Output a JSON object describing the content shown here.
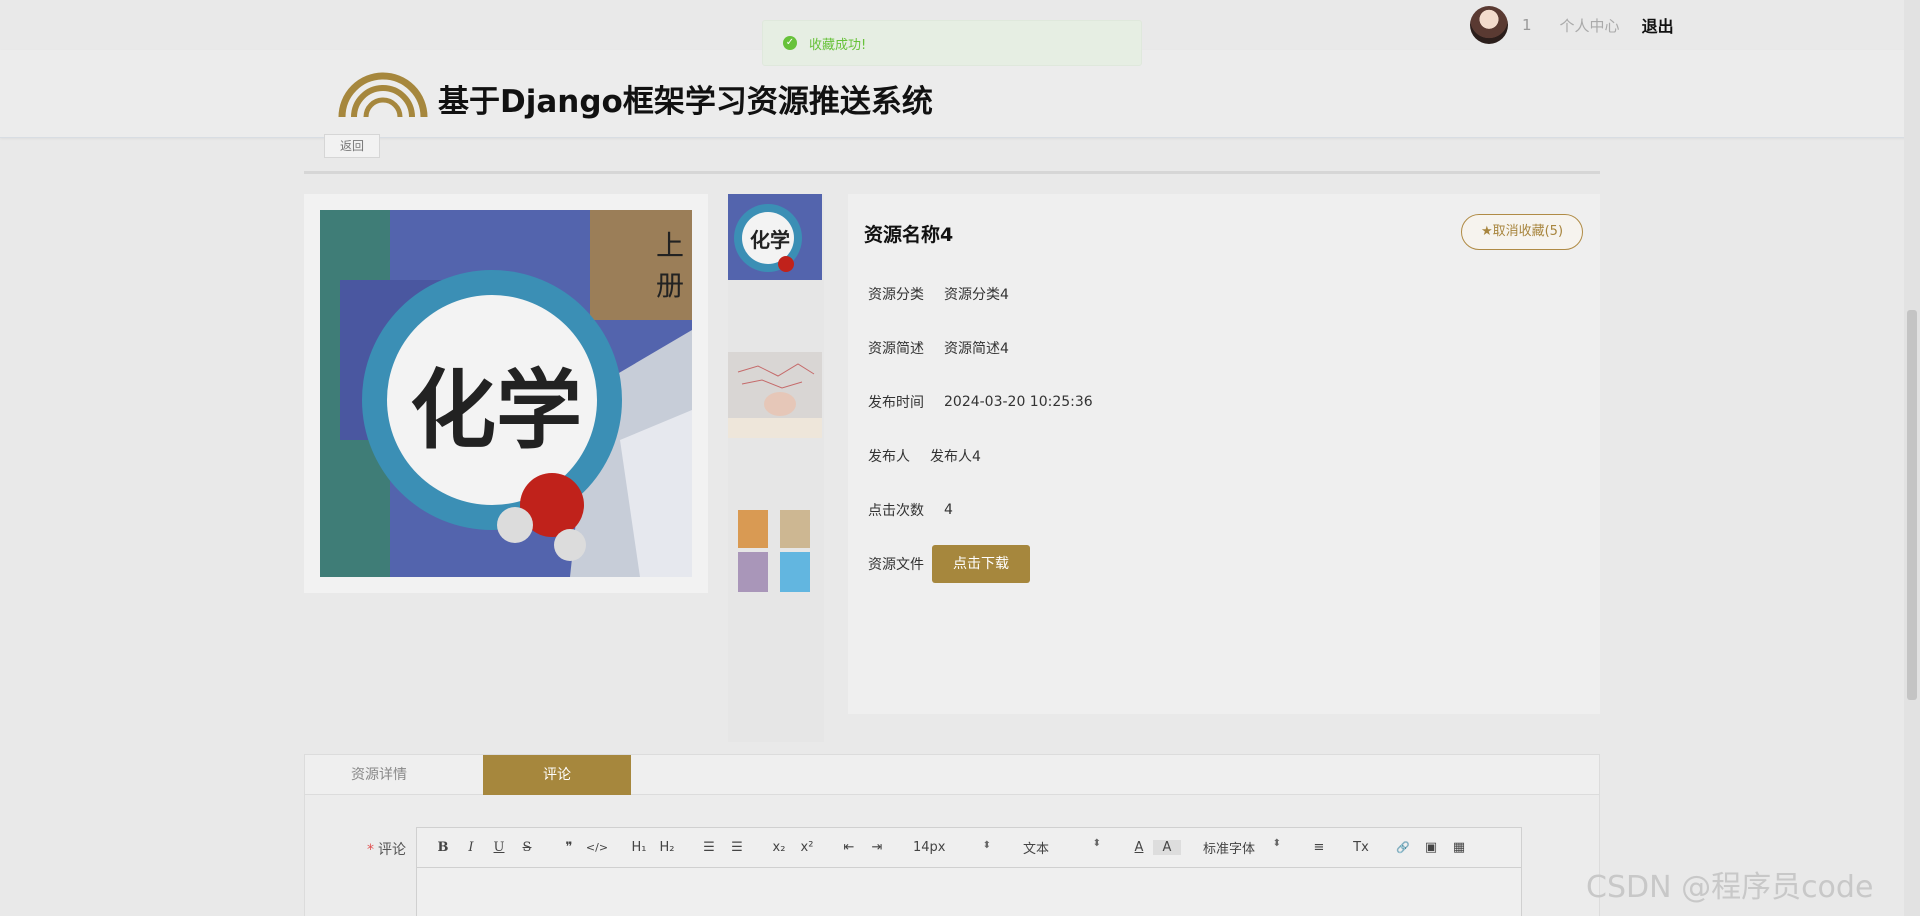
{
  "toast": {
    "message": "收藏成功!"
  },
  "user": {
    "count": "1",
    "personal_center": "个人中心",
    "logout": "退出"
  },
  "header": {
    "title": "基于Django框架学习资源推送系统"
  },
  "back_label": "返回",
  "main_image": {
    "label_big": "化学",
    "label_corner": "上册"
  },
  "thumb_label": "化学",
  "resource": {
    "name": "资源名称4",
    "fav_button": "★取消收藏(5)",
    "fields": [
      {
        "label": "资源分类",
        "value": "资源分类4"
      },
      {
        "label": "资源简述",
        "value": "资源简述4"
      },
      {
        "label": "发布时间",
        "value": "2024-03-20 10:25:36"
      },
      {
        "label": "发布人",
        "value": "发布人4"
      },
      {
        "label": "点击次数",
        "value": "4"
      }
    ],
    "file_label": "资源文件",
    "download_button": "点击下载"
  },
  "tabs": [
    {
      "label": "资源详情"
    },
    {
      "label": "评论"
    }
  ],
  "comment": {
    "required_mark": "*",
    "label": "评论",
    "toolbar": {
      "bold": "B",
      "italic": "I",
      "underline": "U",
      "strike": "S",
      "quote": "❞",
      "code": "</>",
      "h1": "H₁",
      "h2": "H₂",
      "ol": "☰",
      "ul": "☰",
      "sub": "x₂",
      "sup": "x²",
      "outdent": "⇤",
      "indent": "⇥",
      "size_select": "14px",
      "type_select": "文本",
      "font_select": "标准字体",
      "color": "A",
      "bg": "A",
      "align": "≡",
      "clean": "Tx",
      "link": "🔗",
      "image": "▣",
      "video": "▦"
    }
  },
  "watermark": "CSDN @程序员code",
  "colors": {
    "accent": "#a6873d",
    "success": "#67c23a",
    "background": "#e9e9e9"
  }
}
